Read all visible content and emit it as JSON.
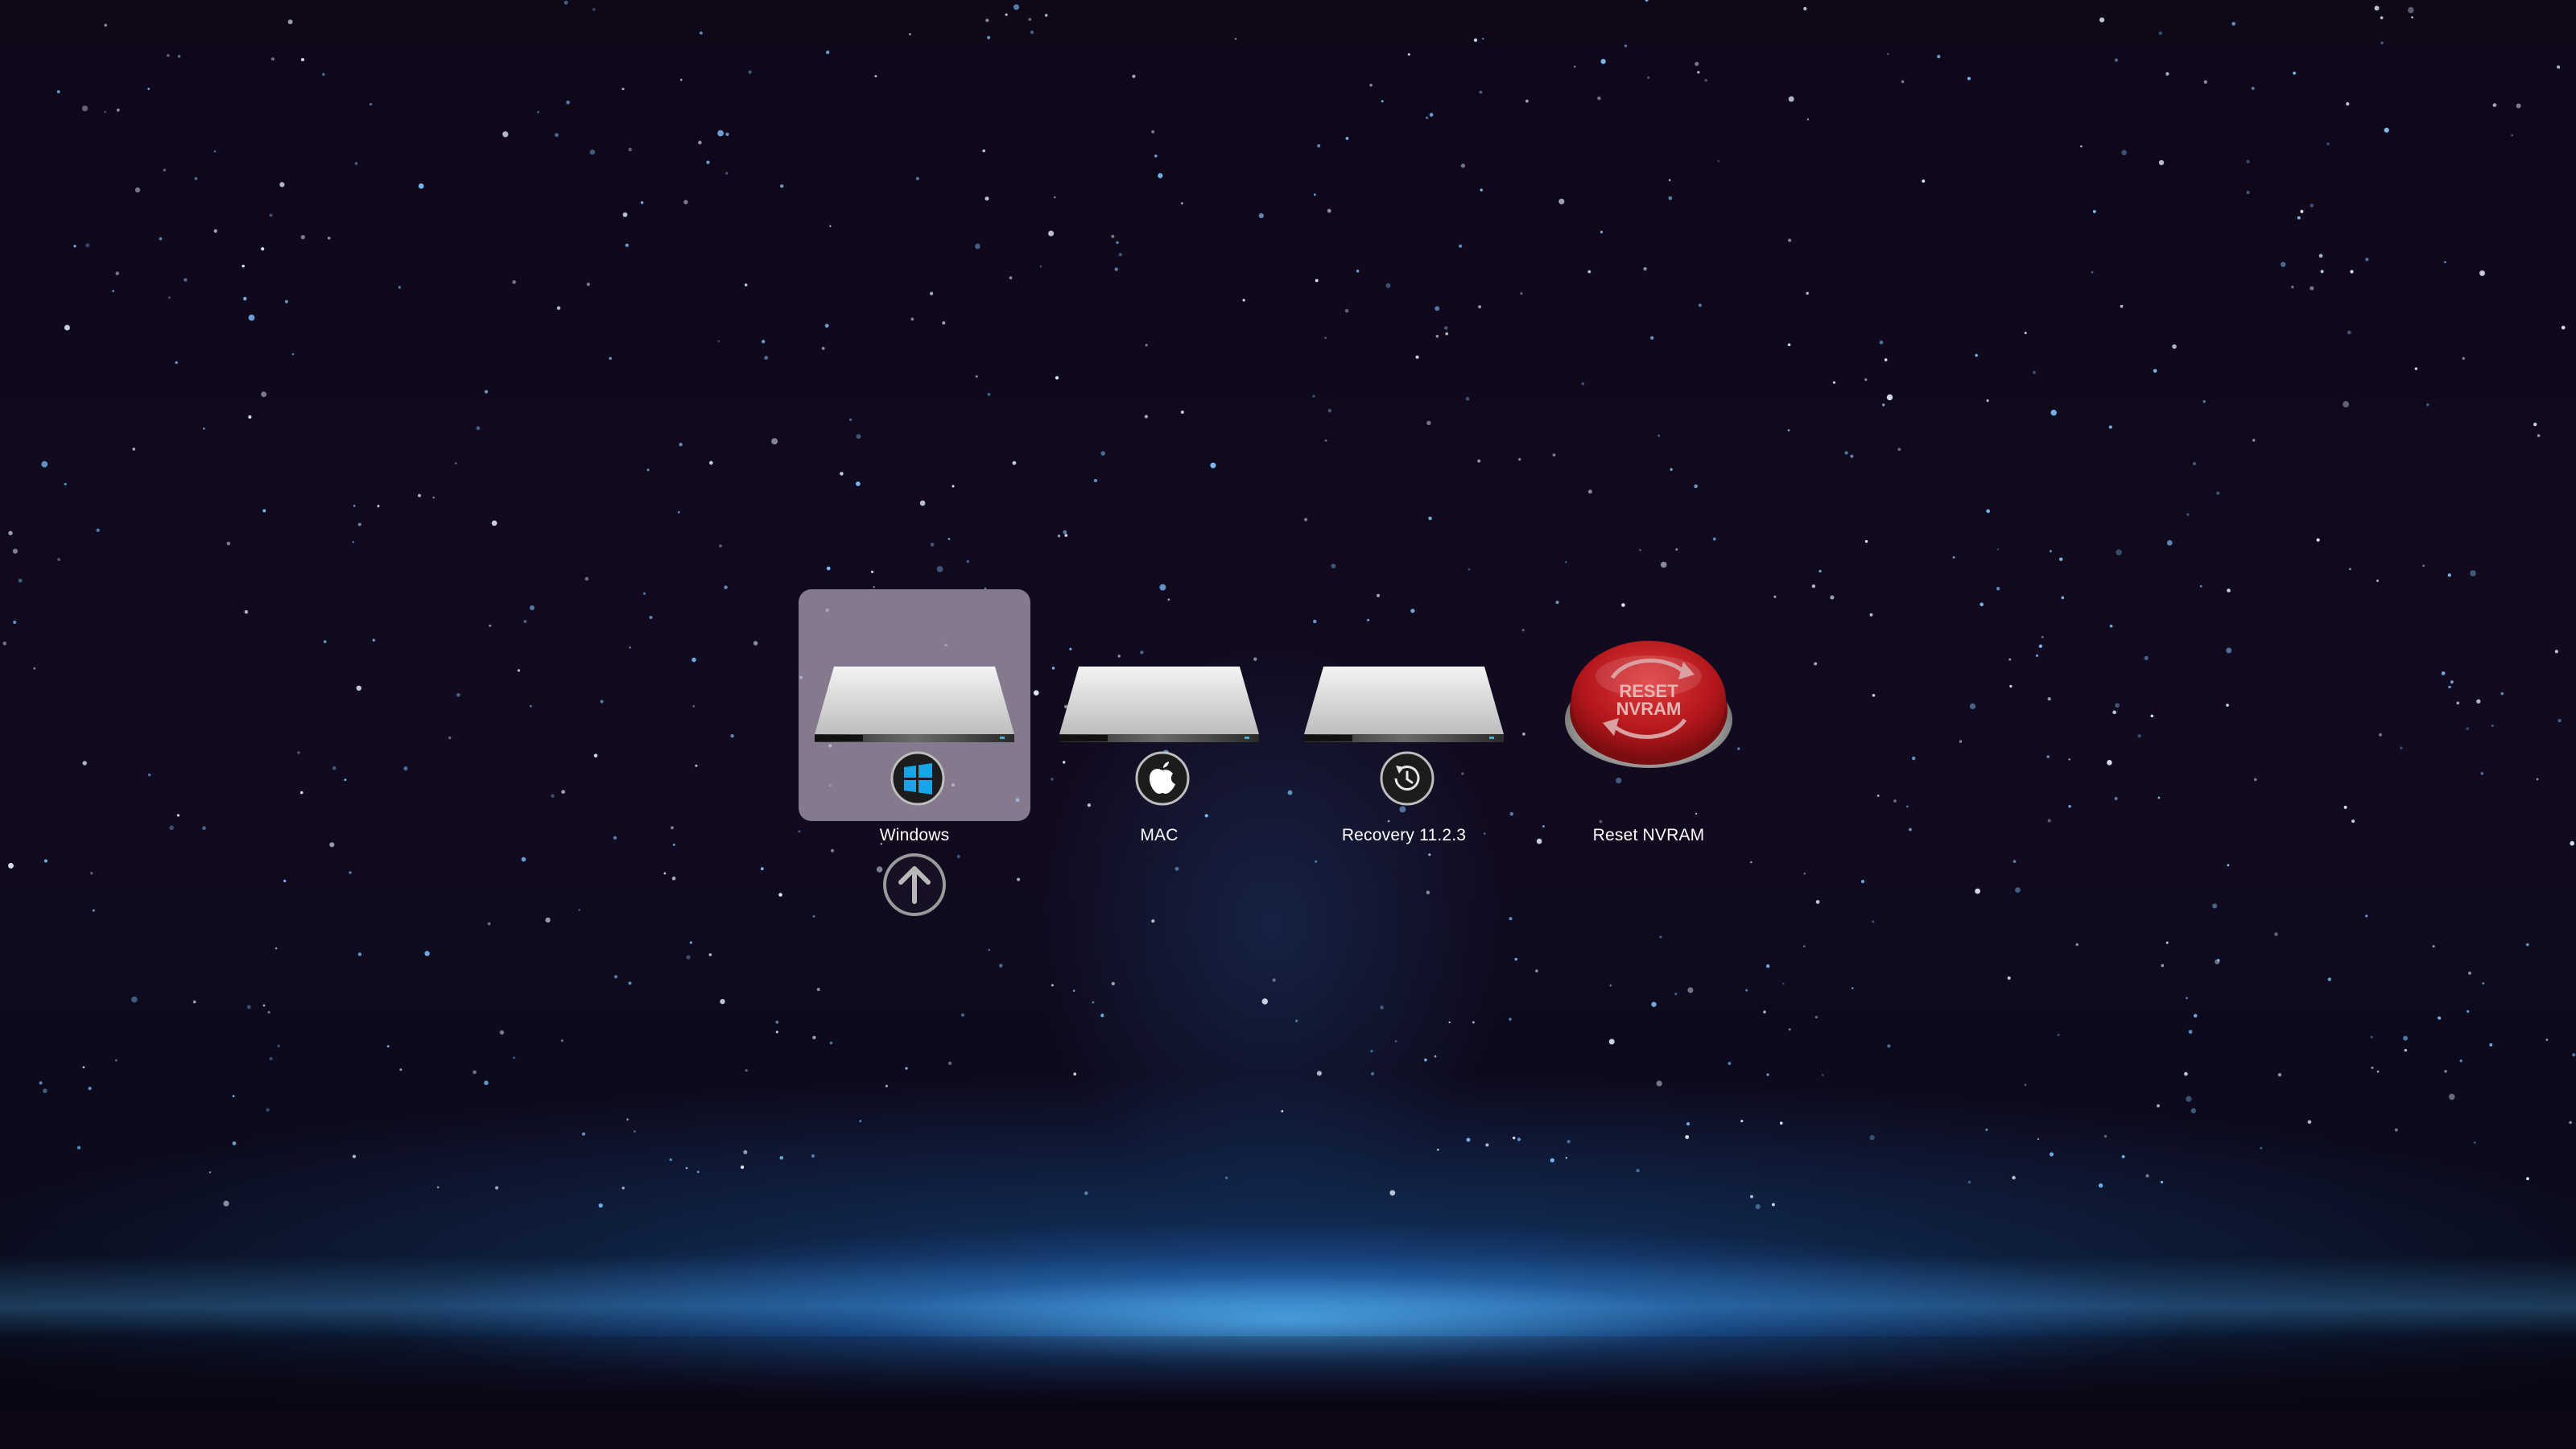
{
  "boot_entries": [
    {
      "label": "Windows",
      "icon": "windows-drive-icon",
      "badge": "windows-logo-icon",
      "selected": true
    },
    {
      "label": "MAC",
      "icon": "mac-drive-icon",
      "badge": "apple-logo-icon",
      "selected": false
    },
    {
      "label": "Recovery 11.2.3",
      "icon": "recovery-drive-icon",
      "badge": "recovery-clock-icon",
      "selected": false
    },
    {
      "label": "Reset NVRAM",
      "icon": "reset-nvram-button-icon",
      "badge": null,
      "selected": false
    }
  ],
  "nvram_button_text": {
    "line1": "RESET",
    "line2": "NVRAM"
  },
  "boot_arrow_icon": "up-arrow-icon",
  "colors": {
    "selection": "#cdbed2",
    "windows_blue": "#1aa3e8",
    "nvram_red": "#b3171b",
    "sky": "#0f0819",
    "horizon_glow": "#4fb4ff"
  }
}
